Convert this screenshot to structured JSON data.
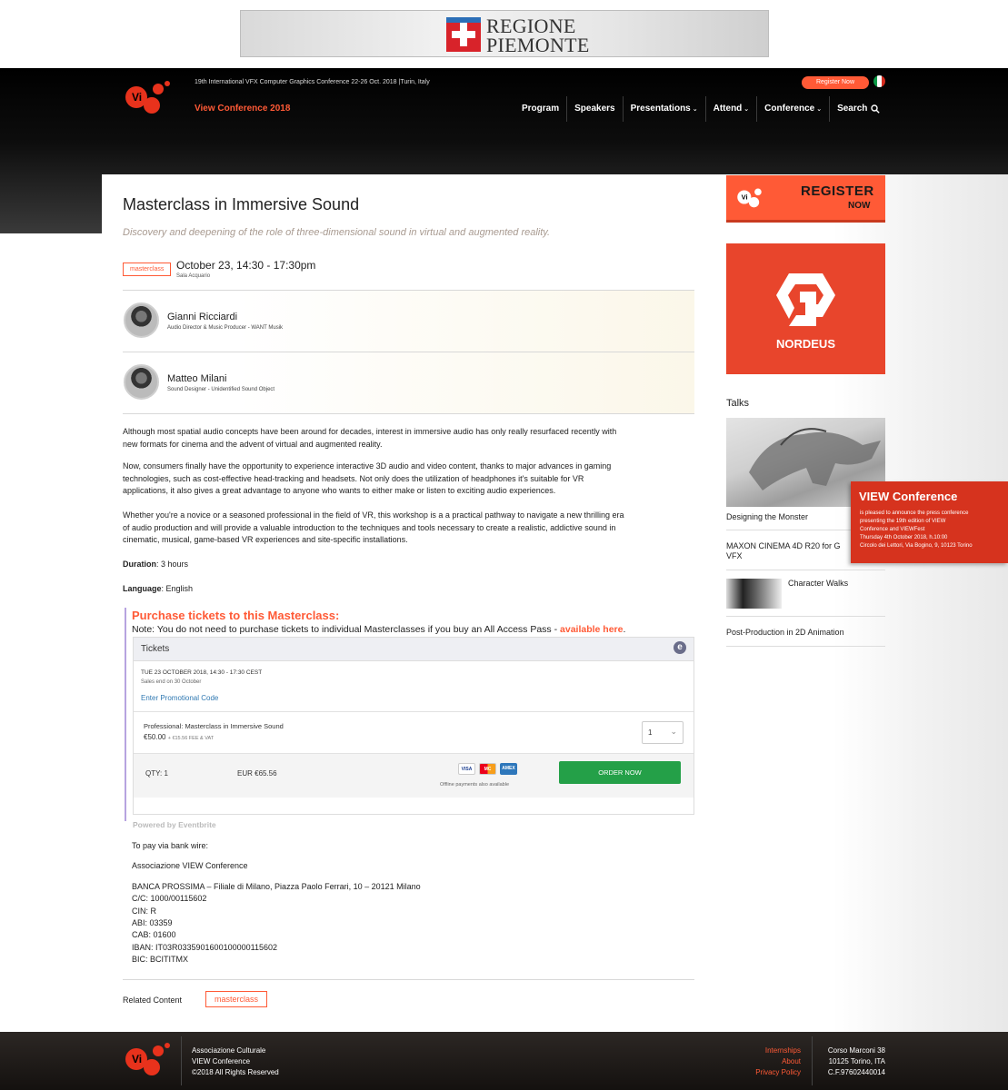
{
  "banner": {
    "line1": "REGIONE",
    "line2": "PIEMONTE"
  },
  "header": {
    "topline": "19th International VFX Computer Graphics Conference 22-26 Oct. 2018 |Turin, Italy",
    "conference_link": "View Conference 2018",
    "register_button": "Register Now",
    "language_flag": "italian-flag-icon",
    "nav": {
      "program": "Program",
      "speakers": "Speakers",
      "presentations": "Presentations",
      "attend": "Attend",
      "conference": "Conference",
      "search": "Search"
    }
  },
  "event": {
    "title": "Masterclass in Immersive Sound",
    "subtitle": "Discovery and deepening of the role of three-dimensional sound in virtual and augmented reality.",
    "tag": "masterclass",
    "date": "October 23, 14:30 - 17:30pm",
    "room": "Sala Acquario"
  },
  "speakers": [
    {
      "name": "Gianni Ricciardi",
      "role": "Audio Director & Music Producer - WANT Musik"
    },
    {
      "name": "Matteo Milani",
      "role": "Sound Designer - Unidentified Sound Object"
    }
  ],
  "description": {
    "p1_line1": "Although most spatial audio concepts have been around for decades, interest in immersive audio has only really resurfaced recently with",
    "p1_line2": "new formats for cinema and the advent of virtual and augmented reality.",
    "p2_line1": "Now, consumers finally have the opportunity to experience interactive 3D audio and video content, thanks to major advances in gaming",
    "p2_line2": "technologies, such as cost-effective head-tracking and headsets. Not only does the utilization of headphones it's suitable for VR",
    "p2_line3": "applications, it also gives a great advantage to anyone who wants to either make or listen to exciting audio experiences.",
    "p3_line1": "Whether you're a novice or a seasoned professional in the field of VR, this workshop is a a practical pathway to navigate a new thrilling era",
    "p3_line2": "of audio production and will provide a valuable introduction to the techniques and tools necessary to create a realistic, addictive sound in",
    "p3_line3": "cinematic, musical, game-based VR experiences and site-specific installations.",
    "duration_label": "Duration",
    "duration_value": ": 3 hours",
    "language_label": "Language",
    "language_value": ": English"
  },
  "purchase": {
    "title": "Purchase tickets to this Masterclass:",
    "note": "Note: You do not need to purchase tickets to individual Masterclasses if you buy an All Access Pass - ",
    "note_link": "available here",
    "note_end": "."
  },
  "eventbrite": {
    "header": "Tickets",
    "logo_letter": "e",
    "date_line": "TUE 23 OCTOBER 2018, 14:30 - 17:30 CEST",
    "sales_end": "Sales end on 30 October",
    "promo_link": "Enter Promotional Code",
    "ticket_name": "Professional: Masterclass in Immersive Sound",
    "price": "€50.00",
    "fee": "+ €15.56 FEE & VAT",
    "qty_selected": "1",
    "qty_summary": "QTY: 1",
    "total": "EUR €65.56",
    "card_visa": "VISA",
    "card_mc": "MC",
    "card_amex": "AMEX",
    "offline": "Offline payments also available",
    "order_button": "ORDER NOW",
    "powered": "Powered by Eventbrite"
  },
  "bank": {
    "intro": "To pay via bank wire:",
    "org": "Associazione VIEW Conference",
    "bank_line": "BANCA PROSSIMA – Filiale di Milano, Piazza Paolo Ferrari, 10 – 20121 Milano",
    "cc": "C/C: 1000/00115602",
    "cin": "CIN: R",
    "abi": "ABI: 03359",
    "cab": "CAB: 01600",
    "iban": "IBAN: IT03R0335901600100000115602",
    "bic": "BIC: BCITITMX"
  },
  "related": {
    "label": "Related Content",
    "tag": "masterclass"
  },
  "sidebar": {
    "register_line1": "REGISTER",
    "register_line2": "NOW",
    "sponsor": "NORDEUS",
    "talks_heading": "Talks",
    "talks": [
      "Designing the Monster",
      "MAXON CINEMA 4D R20 for G",
      "VFX",
      "Character Walks",
      "Post-Production in 2D Animation"
    ]
  },
  "popup": {
    "title": "VIEW Conference",
    "line1": "is pleased to announce the press conference",
    "line2": "presenting the 19th edition of VIEW",
    "line3": "Conference and VIEWFest",
    "line4": "Thursday 4th October 2018, h.10:00",
    "line5": "Circolo dei Lettori, Via Bogino, 9, 10123 Torino"
  },
  "footer": {
    "org1": "Associazione Culturale",
    "org2": "VIEW Conference",
    "org3": "©2018 All Rights Reserved",
    "link1": "Internships",
    "link2": "About",
    "link3": "Privacy Policy",
    "addr1": "Corso Marconi 38",
    "addr2": "10125 Torino, ITA",
    "addr3": "C.F.97602440014"
  },
  "colors": {
    "accent": "#ff5a36",
    "order_green": "#24a048",
    "popup_red": "#d6331e"
  }
}
